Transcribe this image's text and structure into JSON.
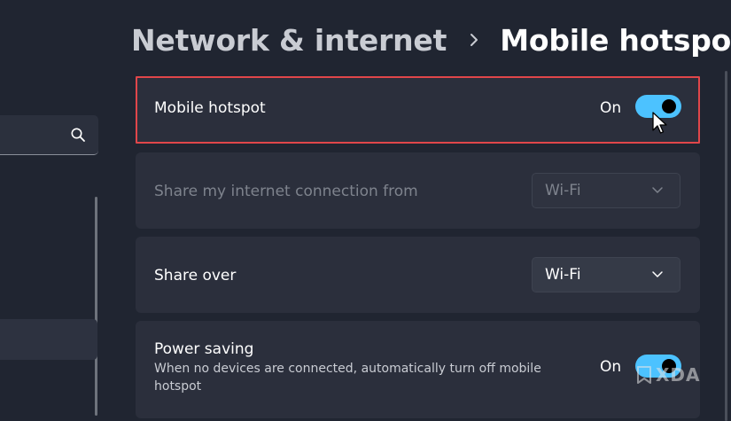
{
  "header": {
    "parent": "Network & internet",
    "current": "Mobile hotspot"
  },
  "sidebar": {
    "search_placeholder": ""
  },
  "settings": {
    "mobile_hotspot": {
      "label": "Mobile hotspot",
      "state": "On",
      "enabled": true
    },
    "share_from": {
      "label": "Share my internet connection from",
      "value": "Wi-Fi",
      "disabled": true
    },
    "share_over": {
      "label": "Share over",
      "value": "Wi-Fi"
    },
    "power_saving": {
      "label": "Power saving",
      "description": "When no devices are connected, automatically turn off mobile hotspot",
      "state": "On",
      "enabled": true
    }
  },
  "watermark": {
    "text": "XDA"
  },
  "colors": {
    "background": "#202531",
    "card": "#2b2f3c",
    "accent": "#4cc2ff",
    "highlight": "#e0464a"
  },
  "icons": [
    "search-icon",
    "chevron-right-icon",
    "chevron-down-icon",
    "mouse-cursor-icon",
    "xda-logo-icon"
  ]
}
